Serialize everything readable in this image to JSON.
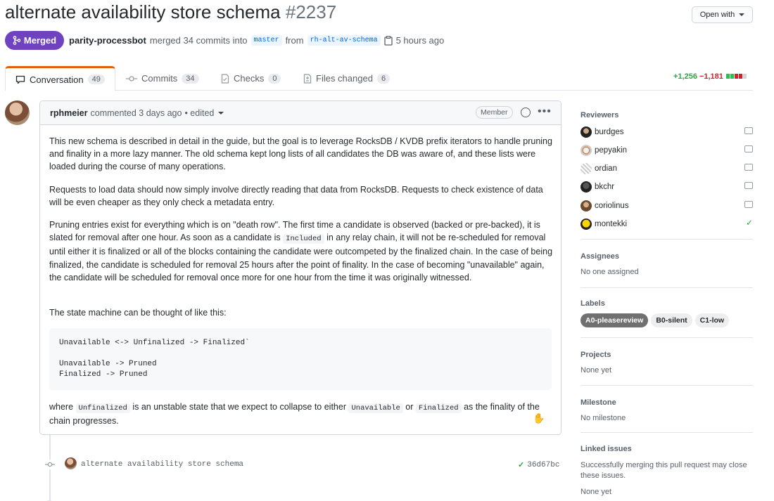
{
  "header": {
    "title": "alternate availability store schema",
    "number": "#2237",
    "open_with": "Open with"
  },
  "status": {
    "badge": "Merged",
    "author": "parity-processbot",
    "action": "merged 34 commits into",
    "base_branch": "master",
    "from": "from",
    "head_branch": "rh-alt-av-schema",
    "time": "5 hours ago",
    "badge_color": "#6f42c1"
  },
  "tabs": [
    {
      "label": "Conversation",
      "count": "49"
    },
    {
      "label": "Commits",
      "count": "34"
    },
    {
      "label": "Checks",
      "count": "0"
    },
    {
      "label": "Files changed",
      "count": "6"
    }
  ],
  "diffstat": {
    "additions": "+1,256",
    "deletions": "−1,181"
  },
  "comment": {
    "author": "rphmeier",
    "meta": "commented 3 days ago",
    "edited": "• edited",
    "role": "Member",
    "p1": "This new schema is described in detail in the guide, but the goal is to leverage RocksDB / KVDB prefix iterators to handle pruning and finality in a more lazy manner. The old schema kept long lists of all candidates the DB was aware of, and these lists were loaded during the course of many operations.",
    "p2": "Requests to load data should now simply involve directly reading that data from RocksDB. Requests to check existence of data will be even cheaper as they only check a metadata entry.",
    "p3a": "Pruning entries exist for everything which is on \"death row\". The first time a candidate is observed (backed or pre-backed), it is slated for removal after one hour. As soon as a candidate is",
    "p3code": "Included",
    "p3b": "in any relay chain, it will not be re-scheduled for removal until either it is finalized or all of the blocks containing the candidate were outcompeted by the finalized chain. In the case of being finalized, the candidate is scheduled for removal 25 hours after the point of finality. In the case of becoming \"unavailable\" again, the candidate will be scheduled for removal once more for one hour from the time it was originally witnessed.",
    "p4": "The state machine can be thought of like this:",
    "code": "Unavailable <-> Unfinalized -> Finalized`\n\nUnavailable -> Pruned\nFinalized -> Pruned",
    "p5a": "where",
    "p5c1": "Unfinalized",
    "p5b": "is an unstable state that we expect to collapse to either",
    "p5c2": "Unavailable",
    "p5or": "or",
    "p5c3": "Finalized",
    "p5d": "as the finality of the chain progresses."
  },
  "commit": {
    "message": "alternate availability store schema",
    "sha": "36d67bc"
  },
  "sidebar": {
    "reviewers_title": "Reviewers",
    "reviewers": [
      {
        "name": "burdges",
        "status": "commented"
      },
      {
        "name": "pepyakin",
        "status": "commented"
      },
      {
        "name": "ordian",
        "status": "commented"
      },
      {
        "name": "bkchr",
        "status": "commented"
      },
      {
        "name": "coriolinus",
        "status": "commented"
      },
      {
        "name": "montekki",
        "status": "approved"
      }
    ],
    "assignees_title": "Assignees",
    "assignees_value": "No one assigned",
    "labels_title": "Labels",
    "labels": [
      {
        "name": "A0-pleasereview",
        "bg": "#707070",
        "fg": "#ffffff"
      },
      {
        "name": "B0-silent",
        "bg": "#eeeeee",
        "fg": "#24292e"
      },
      {
        "name": "C1-low",
        "bg": "#eeeeee",
        "fg": "#24292e"
      }
    ],
    "projects_title": "Projects",
    "projects_value": "None yet",
    "milestone_title": "Milestone",
    "milestone_value": "No milestone",
    "linked_title": "Linked issues",
    "linked_desc": "Successfully merging this pull request may close these issues.",
    "linked_value": "None yet"
  }
}
